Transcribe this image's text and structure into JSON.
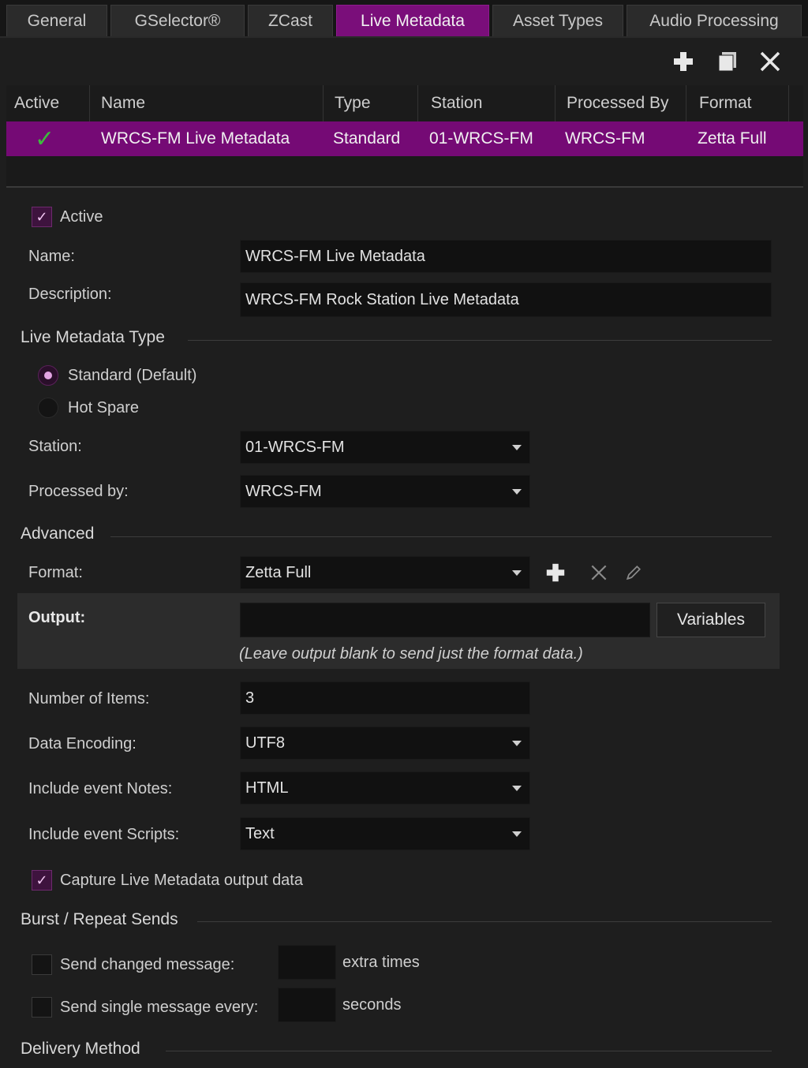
{
  "tabs": [
    {
      "label": "General"
    },
    {
      "label": "GSelector®"
    },
    {
      "label": "ZCast"
    },
    {
      "label": "Live Metadata"
    },
    {
      "label": "Asset Types"
    },
    {
      "label": "Audio Processing"
    }
  ],
  "toolbar": {
    "add_icon": "plus-icon",
    "copy_icon": "copy-icon",
    "delete_icon": "close-icon"
  },
  "grid": {
    "columns": [
      "Active",
      "Name",
      "Type",
      "Station",
      "Processed By",
      "Format"
    ],
    "rows": [
      {
        "active": "✓",
        "name": "WRCS-FM Live Metadata",
        "type": "Standard",
        "station": "01-WRCS-FM",
        "processed_by": "WRCS-FM",
        "format": "Zetta Full"
      }
    ]
  },
  "form": {
    "active_label": "Active",
    "name_label": "Name:",
    "name_value": "WRCS-FM Live Metadata",
    "description_label": "Description:",
    "description_value": "WRCS-FM Rock Station Live Metadata",
    "type_section": "Live Metadata Type",
    "type_standard": "Standard (Default)",
    "type_hot_spare": "Hot Spare",
    "station_label": "Station:",
    "station_value": "01-WRCS-FM",
    "processed_label": "Processed by:",
    "processed_value": "WRCS-FM",
    "advanced_section": "Advanced",
    "format_label": "Format:",
    "format_value": "Zetta Full",
    "output_label": "Output:",
    "output_value": "",
    "variables_button": "Variables",
    "output_hint": "(Leave output blank to send just the format data.)",
    "items_label": "Number of Items:",
    "items_value": "3",
    "encoding_label": "Data Encoding:",
    "encoding_value": "UTF8",
    "notes_label": "Include event Notes:",
    "notes_value": "HTML",
    "scripts_label": "Include event Scripts:",
    "scripts_value": "Text",
    "capture_label": "Capture Live Metadata output data",
    "burst_section": "Burst / Repeat Sends",
    "send_changed_label": "Send changed message:",
    "send_changed_suffix": "extra times",
    "send_single_label": "Send single message every:",
    "send_single_suffix": "seconds",
    "delivery_section": "Delivery Method"
  },
  "colors": {
    "accent": "#750a75",
    "check_green": "#3dbb3d"
  }
}
